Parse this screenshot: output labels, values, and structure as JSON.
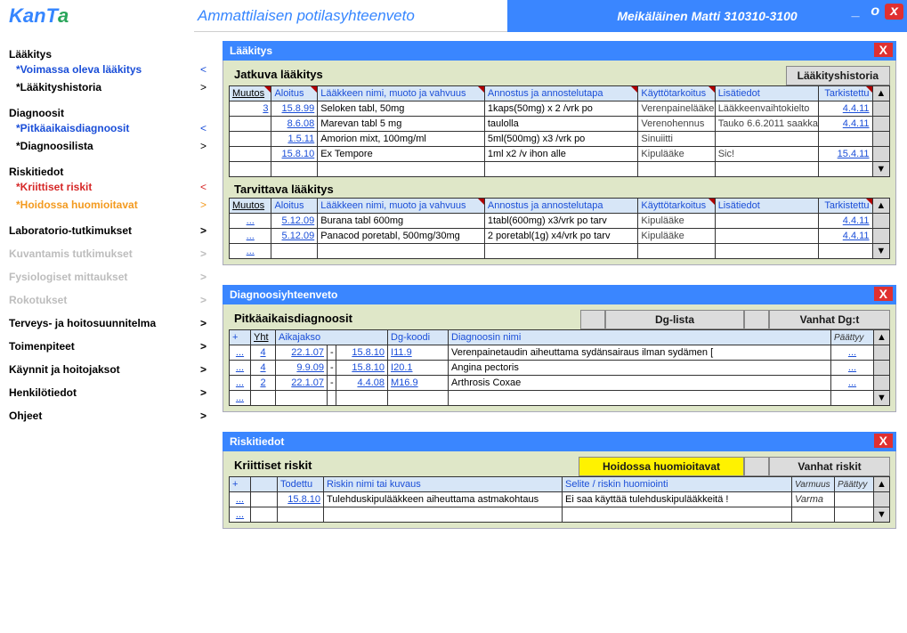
{
  "header": {
    "logo_text": "KanTa",
    "subtitle": "Ammattilaisen potilasyhteenveto",
    "patient": "Meikäläinen Matti 310310-3100",
    "min_label": "_",
    "max_label": "o",
    "close_label": "x"
  },
  "sidebar": [
    {
      "type": "head",
      "label": "Lääkitys",
      "color": "c-black"
    },
    {
      "type": "item",
      "label": "*Voimassa oleva lääkitys",
      "color": "c-blue",
      "chev": "<"
    },
    {
      "type": "item",
      "label": "*Lääkityshistoria",
      "color": "c-black",
      "chev": ">"
    },
    {
      "type": "gap"
    },
    {
      "type": "head",
      "label": "Diagnoosit",
      "color": "c-black"
    },
    {
      "type": "item",
      "label": "*Pitkäaikaisdiagnoosit",
      "color": "c-blue",
      "chev": "<"
    },
    {
      "type": "item",
      "label": "*Diagnoosilista",
      "color": "c-black",
      "chev": ">"
    },
    {
      "type": "gap"
    },
    {
      "type": "head",
      "label": "Riskitiedot",
      "color": "c-black"
    },
    {
      "type": "item",
      "label": "*Kriittiset riskit",
      "color": "c-red",
      "chev": "<",
      "chev_color": "c-red"
    },
    {
      "type": "item",
      "label": "*Hoidossa huomioitavat",
      "color": "c-orange",
      "chev": ">",
      "chev_color": "c-orange"
    },
    {
      "type": "gap"
    },
    {
      "type": "head",
      "label": "Laboratorio-tutkimukset",
      "color": "c-black",
      "chev": ">"
    },
    {
      "type": "gap"
    },
    {
      "type": "head",
      "label": "Kuvantamis tutkimukset",
      "color": "c-dim",
      "chev": ">"
    },
    {
      "type": "gap"
    },
    {
      "type": "head",
      "label": "Fysiologiset mittaukset",
      "color": "c-dim",
      "chev": ">"
    },
    {
      "type": "gap"
    },
    {
      "type": "head",
      "label": "Rokotukset",
      "color": "c-dim",
      "chev": ">"
    },
    {
      "type": "gap"
    },
    {
      "type": "head",
      "label": "Terveys- ja hoitosuunnitelma",
      "color": "c-black",
      "chev": ">"
    },
    {
      "type": "gap"
    },
    {
      "type": "head",
      "label": "Toimenpiteet",
      "color": "c-black",
      "chev": ">"
    },
    {
      "type": "gap"
    },
    {
      "type": "head",
      "label": "Käynnit ja hoitojaksot",
      "color": "c-black",
      "chev": ">"
    },
    {
      "type": "gap"
    },
    {
      "type": "head",
      "label": "Henkilötiedot",
      "color": "c-black",
      "chev": ">"
    },
    {
      "type": "gap"
    },
    {
      "type": "head",
      "label": "Ohjeet",
      "color": "c-black",
      "chev": ">"
    }
  ],
  "meds_panel": {
    "title": "Lääkitys",
    "history_tab": "Lääkityshistoria",
    "cont_title": "Jatkuva lääkitys",
    "need_title": "Tarvittava lääkitys",
    "cols": {
      "muutos": "Muutos",
      "aloitus": "Aloitus",
      "nimi": "Lääkkeen nimi, muoto ja vahvuus",
      "annos": "Annostus ja annostelutapa",
      "tark": "Käyttötarkoitus",
      "lisa": "Lisätiedot",
      "tarkistettu": "Tarkistettu"
    },
    "cont_rows": [
      {
        "muutos": "3",
        "aloitus": "15.8.99",
        "nimi": "Seloken tabl, 50mg",
        "annos": "1kaps(50mg) x 2 /vrk po",
        "tark": "Verenpainelääke",
        "lisa": "Lääkkeenvaihtokielto",
        "check": "4.4.11"
      },
      {
        "muutos": "",
        "aloitus": "8.6.08",
        "nimi": "Marevan tabl 5 mg",
        "annos": "taulolla",
        "tark": "Verenohennus",
        "lisa": "Tauko 6.6.2011 saakka",
        "check": "4.4.11"
      },
      {
        "muutos": "",
        "aloitus": "1.5.11",
        "nimi": "Amorion mixt, 100mg/ml",
        "annos": "5ml(500mg) x3 /vrk po",
        "tark": "Sinuiitti",
        "lisa": "",
        "check": ""
      },
      {
        "muutos": "",
        "aloitus": "15.8.10",
        "nimi": "Ex Tempore",
        "annos": "1ml x2 /v ihon alle",
        "tark": "Kipulääke",
        "lisa": "Sic!",
        "check": "15.4.11"
      },
      {
        "muutos": "",
        "aloitus": "",
        "nimi": "",
        "annos": "",
        "tark": "",
        "lisa": "",
        "check": ""
      }
    ],
    "need_rows": [
      {
        "muutos": "...",
        "aloitus": "5.12.09",
        "nimi": "Burana tabl 600mg",
        "annos": "1tabl(600mg) x3/vrk po tarv",
        "tark": "Kipulääke",
        "lisa": "",
        "check": "4.4.11"
      },
      {
        "muutos": "...",
        "aloitus": "5.12.09",
        "nimi": "Panacod poretabl, 500mg/30mg",
        "annos": "2 poretabl(1g) x4/vrk po tarv",
        "tark": "Kipulääke",
        "lisa": "",
        "check": "4.4.11"
      },
      {
        "muutos": "...",
        "aloitus": "",
        "nimi": "",
        "annos": "",
        "tark": "",
        "lisa": "",
        "check": ""
      }
    ]
  },
  "dg_panel": {
    "title": "Diagnoosiyhteenveto",
    "sub": "Pitkäaikaisdiagnoosit",
    "tab1": "Dg-lista",
    "tab2": "Vanhat Dg:t",
    "cols": {
      "plus": "+",
      "yht": "Yht",
      "aika": "Aikajakso",
      "koodi": "Dg-koodi",
      "nimi": "Diagnoosin nimi",
      "end": "Päättyy"
    },
    "rows": [
      {
        "plus": "...",
        "yht": "4",
        "a1": "22.1.07",
        "a2": "15.8.10",
        "koodi": "I11.9",
        "nimi": "Verenpainetaudin aiheuttama sydänsairaus ilman sydämen [",
        "end": "..."
      },
      {
        "plus": "...",
        "yht": "4",
        "a1": "9.9.09",
        "a2": "15.8.10",
        "koodi": "I20.1",
        "nimi": "Angina pectoris",
        "end": "..."
      },
      {
        "plus": "...",
        "yht": "2",
        "a1": "22.1.07",
        "a2": "4.4.08",
        "koodi": "M16.9",
        "nimi": "Arthrosis Coxae",
        "end": "..."
      },
      {
        "plus": "...",
        "yht": "",
        "a1": "",
        "a2": "",
        "koodi": "",
        "nimi": "",
        "end": ""
      }
    ]
  },
  "risk_panel": {
    "title": "Riskitiedot",
    "sub": "Kriittiset riskit",
    "tab1": "Hoidossa huomioitavat",
    "tab2": "Vanhat riskit",
    "cols": {
      "plus": "+",
      "todettu": "Todettu",
      "nimi": "Riskin nimi tai kuvaus",
      "selite": "Selite / riskin huomiointi",
      "varmuus": "Varmuus",
      "end": "Päättyy"
    },
    "rows": [
      {
        "plus": "...",
        "todettu": "15.8.10",
        "nimi": "Tulehduskipulääkkeen aiheuttama astmakohtaus",
        "selite": "Ei saa käyttää tulehduskipulääkkeitä !",
        "varmuus": "Varma",
        "end": ""
      },
      {
        "plus": "...",
        "todettu": "",
        "nimi": "",
        "selite": "",
        "varmuus": "",
        "end": ""
      }
    ]
  },
  "scroll": {
    "up": "▲",
    "down": "▼"
  }
}
